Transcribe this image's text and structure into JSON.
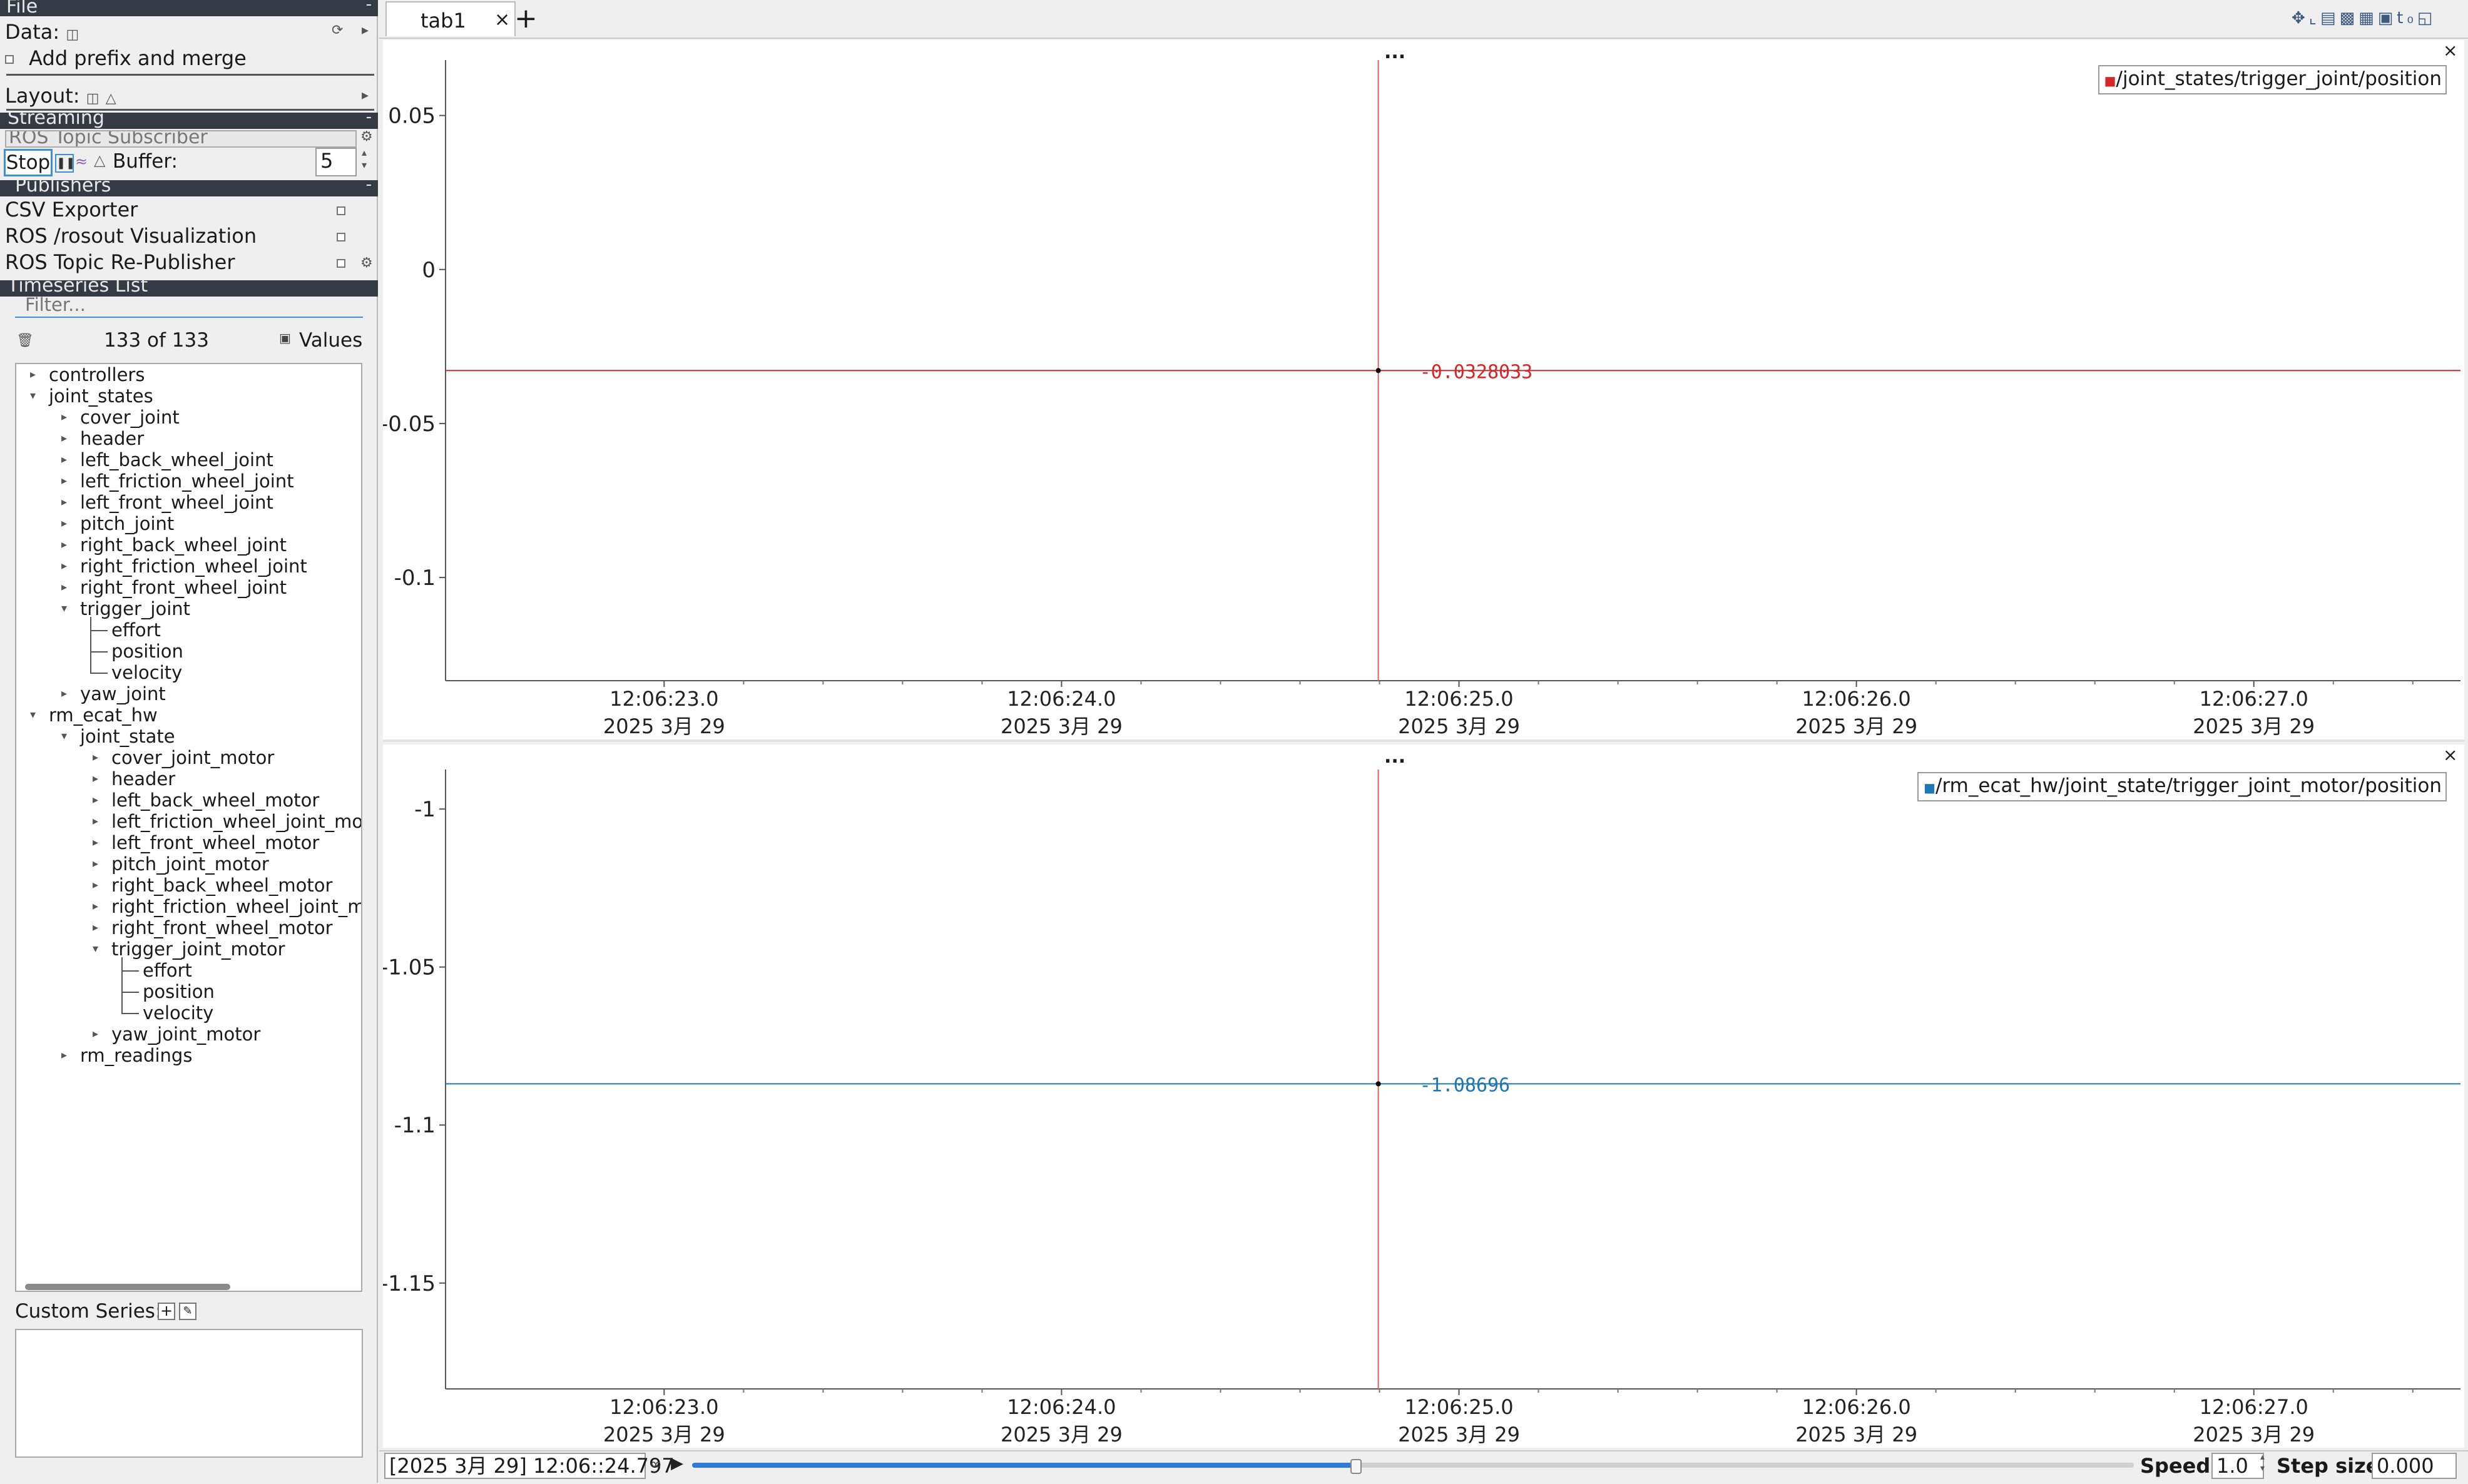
{
  "menu": {
    "file_label": "File"
  },
  "data_section": {
    "data_label": "Data:",
    "prefix_merge_label": "Add prefix and merge",
    "layout_label": "Layout:"
  },
  "streaming": {
    "header": "Streaming",
    "subscriber_selected": "ROS Topic Subscriber",
    "stop_label": "Stop",
    "buffer_label": "Buffer:",
    "buffer_value": "5"
  },
  "publishers": {
    "header": "Publishers",
    "items": [
      {
        "label": "CSV Exporter"
      },
      {
        "label": "ROS /rosout Visualization"
      },
      {
        "label": "ROS Topic Re-Publisher"
      }
    ]
  },
  "timeseries": {
    "header": "Timeseries List",
    "filter_placeholder": "Filter...",
    "count_label": "133 of 133",
    "values_label": "Values"
  },
  "tree": [
    {
      "label": "controllers",
      "level": 0,
      "arrow": "right"
    },
    {
      "label": "joint_states",
      "level": 0,
      "arrow": "down"
    },
    {
      "label": "cover_joint",
      "level": 1,
      "arrow": "right"
    },
    {
      "label": "header",
      "level": 1,
      "arrow": "right"
    },
    {
      "label": "left_back_wheel_joint",
      "level": 1,
      "arrow": "right"
    },
    {
      "label": "left_friction_wheel_joint",
      "level": 1,
      "arrow": "right"
    },
    {
      "label": "left_front_wheel_joint",
      "level": 1,
      "arrow": "right"
    },
    {
      "label": "pitch_joint",
      "level": 1,
      "arrow": "right"
    },
    {
      "label": "right_back_wheel_joint",
      "level": 1,
      "arrow": "right"
    },
    {
      "label": "right_friction_wheel_joint",
      "level": 1,
      "arrow": "right"
    },
    {
      "label": "right_front_wheel_joint",
      "level": 1,
      "arrow": "right"
    },
    {
      "label": "trigger_joint",
      "level": 1,
      "arrow": "down"
    },
    {
      "label": "effort",
      "level": 2,
      "arrow": "leaf"
    },
    {
      "label": "position",
      "level": 2,
      "arrow": "leaf"
    },
    {
      "label": "velocity",
      "level": 2,
      "arrow": "leaf"
    },
    {
      "label": "yaw_joint",
      "level": 1,
      "arrow": "right"
    },
    {
      "label": "rm_ecat_hw",
      "level": 0,
      "arrow": "down"
    },
    {
      "label": "joint_state",
      "level": 1,
      "arrow": "down"
    },
    {
      "label": "cover_joint_motor",
      "level": 2,
      "arrow": "right"
    },
    {
      "label": "header",
      "level": 2,
      "arrow": "right"
    },
    {
      "label": "left_back_wheel_motor",
      "level": 2,
      "arrow": "right"
    },
    {
      "label": "left_friction_wheel_joint_mot",
      "level": 2,
      "arrow": "right"
    },
    {
      "label": "left_front_wheel_motor",
      "level": 2,
      "arrow": "right"
    },
    {
      "label": "pitch_joint_motor",
      "level": 2,
      "arrow": "right"
    },
    {
      "label": "right_back_wheel_motor",
      "level": 2,
      "arrow": "right"
    },
    {
      "label": "right_friction_wheel_joint_mo",
      "level": 2,
      "arrow": "right"
    },
    {
      "label": "right_front_wheel_motor",
      "level": 2,
      "arrow": "right"
    },
    {
      "label": "trigger_joint_motor",
      "level": 2,
      "arrow": "down"
    },
    {
      "label": "effort",
      "level": 3,
      "arrow": "leaf"
    },
    {
      "label": "position",
      "level": 3,
      "arrow": "leaf"
    },
    {
      "label": "velocity",
      "level": 3,
      "arrow": "leaf"
    },
    {
      "label": "yaw_joint_motor",
      "level": 2,
      "arrow": "right"
    },
    {
      "label": "rm_readings",
      "level": 1,
      "arrow": "right"
    }
  ],
  "custom_series": {
    "label": "Custom Series:"
  },
  "tabs": [
    {
      "label": "tab1"
    }
  ],
  "plot_menu": "...",
  "plots": [
    {
      "legend": "/joint_states/trigger_joint/position",
      "color": "#d62728",
      "value_label": "-0.0328033",
      "value": -0.0328033,
      "y_range": [
        -0.1335,
        0.068
      ],
      "y_ticks": [
        {
          "v": 0.05,
          "t": "0.05"
        },
        {
          "v": 0,
          "t": "0"
        },
        {
          "v": -0.05,
          "t": "-0.05"
        },
        {
          "v": -0.1,
          "t": "-0.1"
        }
      ]
    },
    {
      "legend": "/rm_ecat_hw/joint_state/trigger_joint_motor/position",
      "color": "#1f77b4",
      "value_label": "-1.08696",
      "value": -1.08696,
      "y_range": [
        -1.1835,
        -0.9875
      ],
      "y_ticks": [
        {
          "v": -1,
          "t": "-1"
        },
        {
          "v": -1.05,
          "t": "-1.05"
        },
        {
          "v": -1.1,
          "t": "-1.1"
        },
        {
          "v": -1.15,
          "t": "-1.15"
        }
      ]
    }
  ],
  "x_ticks": [
    {
      "time": "12:06:23.0",
      "date": "2025 3月 29"
    },
    {
      "time": "12:06:24.0",
      "date": "2025 3月 29"
    },
    {
      "time": "12:06:25.0",
      "date": "2025 3月 29"
    },
    {
      "time": "12:06:26.0",
      "date": "2025 3月 29"
    },
    {
      "time": "12:06:27.0",
      "date": "2025 3月 29"
    }
  ],
  "x_range_seconds": [
    22.45,
    27.52
  ],
  "cursor_time_seconds": 24.797,
  "playback": {
    "time_display": "[2025 3月 29] 12:06::24.797",
    "progress": 0.46,
    "speed_label": "Speed:",
    "speed_value": "1.0",
    "step_label": "Step size:",
    "step_value": "0.000"
  }
}
